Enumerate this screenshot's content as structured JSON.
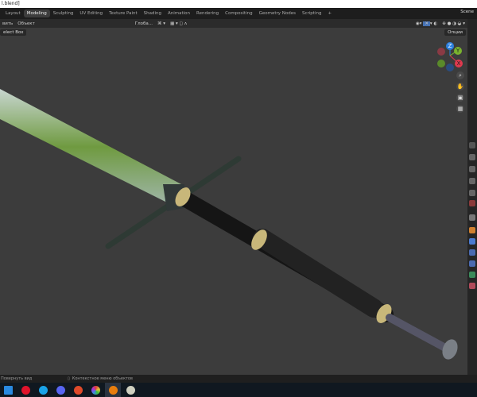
{
  "window": {
    "title": "l.blend]"
  },
  "tabs": [
    "Layout",
    "Modeling",
    "Sculpting",
    "UV Editing",
    "Texture Paint",
    "Shading",
    "Animation",
    "Rendering",
    "Compositing",
    "Geometry Nodes",
    "Scripting",
    "+"
  ],
  "active_tab": "Modeling",
  "scene": "Scene",
  "header": {
    "menu_left": "вить",
    "menu_object": "Объект",
    "transform": "Глоба...",
    "options": "Опции"
  },
  "toolbar": {
    "select": "elect Box"
  },
  "gizmo": {
    "z": "Z",
    "y": "Y",
    "x": "X",
    "colors": {
      "x": "#e0394e",
      "y": "#7ab32e",
      "z": "#2d81e0"
    }
  },
  "status": {
    "left": "Повернуть вид",
    "middle": "Контекстное меню объектов"
  },
  "taskbar": {
    "apps": [
      {
        "name": "mail",
        "color": "#2a8ae0"
      },
      {
        "name": "opera",
        "color": "#e0132b"
      },
      {
        "name": "skype",
        "color": "#1aa3e8"
      },
      {
        "name": "discord",
        "color": "#5865f2"
      },
      {
        "name": "app-red",
        "color": "#e04a2a"
      },
      {
        "name": "photos",
        "color": "#c0a030"
      },
      {
        "name": "blender",
        "color": "#e87d0d"
      },
      {
        "name": "paint",
        "color": "#d0d0c0"
      }
    ],
    "active": "blender"
  }
}
